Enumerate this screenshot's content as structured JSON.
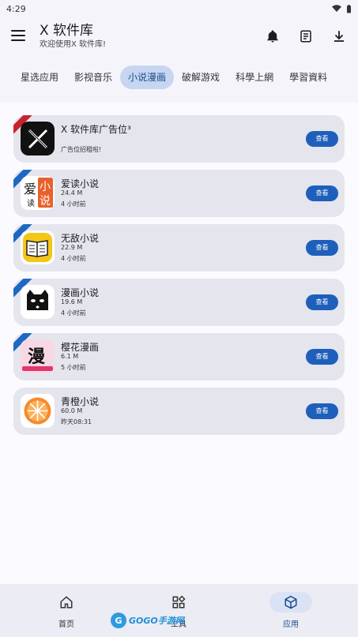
{
  "status_bar": {
    "time": "4:29"
  },
  "header": {
    "title": "X 软件库",
    "subtitle": "欢迎使用X 软件库!",
    "icons": [
      "bell-icon",
      "notes-icon",
      "download-icon"
    ]
  },
  "tabs": [
    {
      "label": "星选应用",
      "active": false
    },
    {
      "label": "影视音乐",
      "active": false
    },
    {
      "label": "小说漫画",
      "active": true
    },
    {
      "label": "破解游戏",
      "active": false
    },
    {
      "label": "科學上網",
      "active": false
    },
    {
      "label": "學習資料",
      "active": false
    }
  ],
  "apps": [
    {
      "name": "X 软件库广告位³",
      "meta1": "",
      "meta2": "广告位招租啦!",
      "button": "查看",
      "ribbon": "red",
      "icon": "x-logo-icon"
    },
    {
      "name": "爱读小说",
      "meta1": "24.4 M",
      "meta2": "4 小时前",
      "button": "查看",
      "ribbon": "blue",
      "icon": "aidu-icon"
    },
    {
      "name": "无敌小说",
      "meta1": "22.9 M",
      "meta2": "4 小时前",
      "button": "查看",
      "ribbon": "blue",
      "icon": "book-icon"
    },
    {
      "name": "漫画小说",
      "meta1": "19.6 M",
      "meta2": "4 小时前",
      "button": "查看",
      "ribbon": "blue",
      "icon": "cat-icon"
    },
    {
      "name": "樱花漫画",
      "meta1": "6.1 M",
      "meta2": "5 小时前",
      "button": "查看",
      "ribbon": "blue",
      "icon": "manhua-icon"
    },
    {
      "name": "青橙小说",
      "meta1": "60.0 M",
      "meta2": "昨天08:31",
      "button": "查看",
      "ribbon": "",
      "icon": "orange-icon"
    }
  ],
  "app_icon_text": {
    "aidu_1": "爱",
    "aidu_2": "小",
    "aidu_3": "说",
    "aidu_4": "读",
    "manhua": "漫"
  },
  "bottom_nav": [
    {
      "label": "首页",
      "active": false,
      "icon": "home-icon"
    },
    {
      "label": "工具",
      "active": false,
      "icon": "widgets-icon"
    },
    {
      "label": "应用",
      "active": true,
      "icon": "cube-icon"
    }
  ],
  "watermark": {
    "text": "GOGO手游网"
  },
  "colors": {
    "accent": "#1e5fbb",
    "ribbon_red": "#c8232c",
    "ribbon_blue": "#1e67c4",
    "tab_active_bg": "#c6d6f0"
  }
}
